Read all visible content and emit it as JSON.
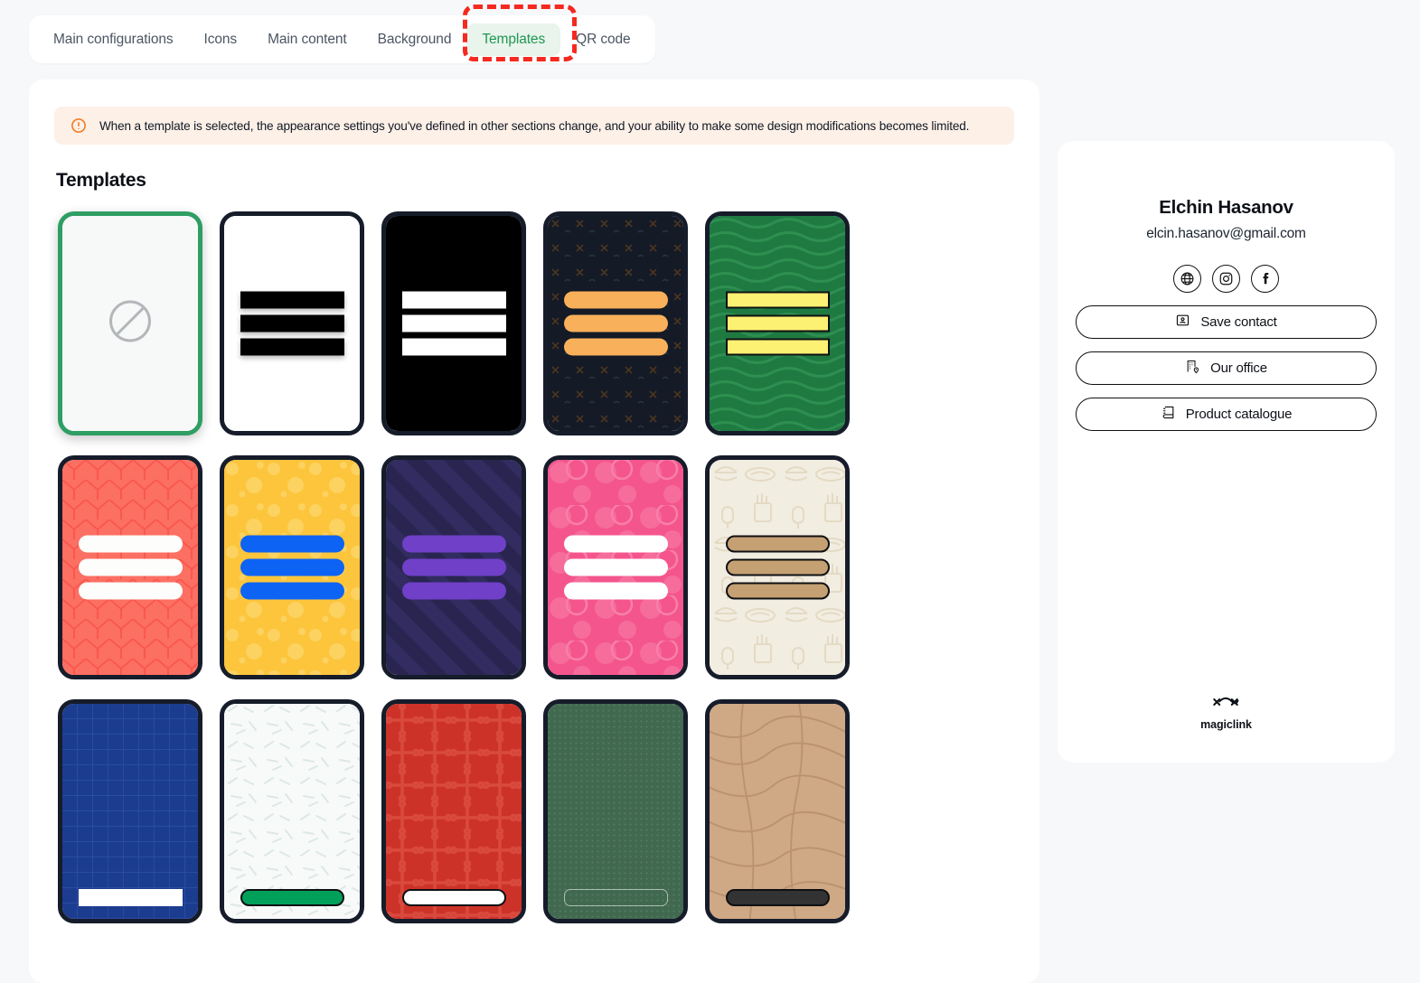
{
  "tabs": [
    {
      "label": "Main configurations",
      "active": false,
      "name": "tab-main-configurations"
    },
    {
      "label": "Icons",
      "active": false,
      "name": "tab-icons"
    },
    {
      "label": "Main content",
      "active": false,
      "name": "tab-main-content"
    },
    {
      "label": "Background",
      "active": false,
      "name": "tab-background"
    },
    {
      "label": "Templates",
      "active": true,
      "name": "tab-templates"
    },
    {
      "label": "QR code",
      "active": false,
      "name": "tab-qr-code"
    }
  ],
  "alert": {
    "icon": "alert-circle-icon",
    "text": "When a template is selected, the appearance settings you've defined in other sections change, and your ability to make some design modifications becomes limited.",
    "bg_color": "#fdf0e6",
    "icon_color": "#f2741c"
  },
  "section": {
    "title": "Templates"
  },
  "accent_color": "#219653",
  "annotation": {
    "color": "#f5291f",
    "target": "tab-templates"
  },
  "templates": [
    {
      "name": "template-none",
      "selected": true,
      "bg": "#f7f8f8",
      "pattern": "none",
      "bar_color": "",
      "bar_shape": "none",
      "icon": "no-template-icon"
    },
    {
      "name": "template-white-black",
      "selected": false,
      "bg": "#ffffff",
      "pattern": "plain",
      "bar_color": "#000000",
      "bar_shape": "square",
      "shadow": true
    },
    {
      "name": "template-black-white",
      "selected": false,
      "bg": "#000000",
      "pattern": "plain",
      "bar_color": "#ffffff",
      "bar_shape": "square"
    },
    {
      "name": "template-dark-cross-orange",
      "selected": false,
      "bg": "#141a26",
      "pattern": "crosses",
      "bar_color": "#f9b05a",
      "bar_shape": "round"
    },
    {
      "name": "template-green-wave-yellow",
      "selected": false,
      "bg": "#1f7a42",
      "pattern": "waves",
      "bar_color": "#fdf173",
      "bar_shape": "square-outline"
    },
    {
      "name": "template-coral-chevron-white",
      "selected": false,
      "bg": "#fc6f63",
      "pattern": "chevron",
      "bar_color": "#fdfdfb",
      "bar_shape": "round"
    },
    {
      "name": "template-yellow-dots-blue",
      "selected": false,
      "bg": "#fcc53c",
      "pattern": "dots",
      "bar_color": "#0d63f4",
      "bar_shape": "round"
    },
    {
      "name": "template-navy-stripes-purple",
      "selected": false,
      "bg": "#292550",
      "pattern": "diagonal",
      "bar_color": "#7040c8",
      "bar_shape": "round"
    },
    {
      "name": "template-pink-circles-white",
      "selected": false,
      "bg": "#f4558c",
      "pattern": "circles",
      "bar_color": "#ffffff",
      "bar_shape": "round"
    },
    {
      "name": "template-cream-food-tan",
      "selected": false,
      "bg": "#f2ede1",
      "pattern": "food",
      "bar_color": "#c5a073",
      "bar_shape": "round-outline"
    },
    {
      "name": "template-blue-grid-white",
      "selected": false,
      "bg": "#1c3d8f",
      "pattern": "grid",
      "bar_color": "#ffffff",
      "bar_shape": "square"
    },
    {
      "name": "template-white-lines-green",
      "selected": false,
      "bg": "#f7faf9",
      "pattern": "lines",
      "bar_color": "#01a05a",
      "bar_shape": "round"
    },
    {
      "name": "template-red-ornament-white",
      "selected": false,
      "bg": "#cd3228",
      "pattern": "ornament",
      "bar_color": "#ffffff",
      "bar_shape": "round-outline"
    },
    {
      "name": "template-green-dots-outline",
      "selected": false,
      "bg": "#40694f",
      "pattern": "microdots",
      "bar_color": "transparent",
      "bar_shape": "outline"
    },
    {
      "name": "template-tan-topo-dark",
      "selected": false,
      "bg": "#cfa885",
      "pattern": "topo",
      "bar_color": "#333333",
      "bar_shape": "round"
    }
  ],
  "preview": {
    "name": "Elchin Hasanov",
    "email": "elcin.hasanov@gmail.com",
    "socials": [
      {
        "name": "globe-icon",
        "label": "Website"
      },
      {
        "name": "instagram-icon",
        "label": "Instagram"
      },
      {
        "name": "facebook-icon",
        "label": "Facebook"
      }
    ],
    "buttons": [
      {
        "name": "save-contact-button",
        "label": "Save contact",
        "icon": "contact-card-icon"
      },
      {
        "name": "our-office-button",
        "label": "Our office",
        "icon": "building-pin-icon"
      },
      {
        "name": "product-catalogue-button",
        "label": "Product catalogue",
        "icon": "catalogue-book-icon"
      }
    ],
    "footer": {
      "logo": "magiclink-logo-icon",
      "label": "magiclink"
    }
  }
}
